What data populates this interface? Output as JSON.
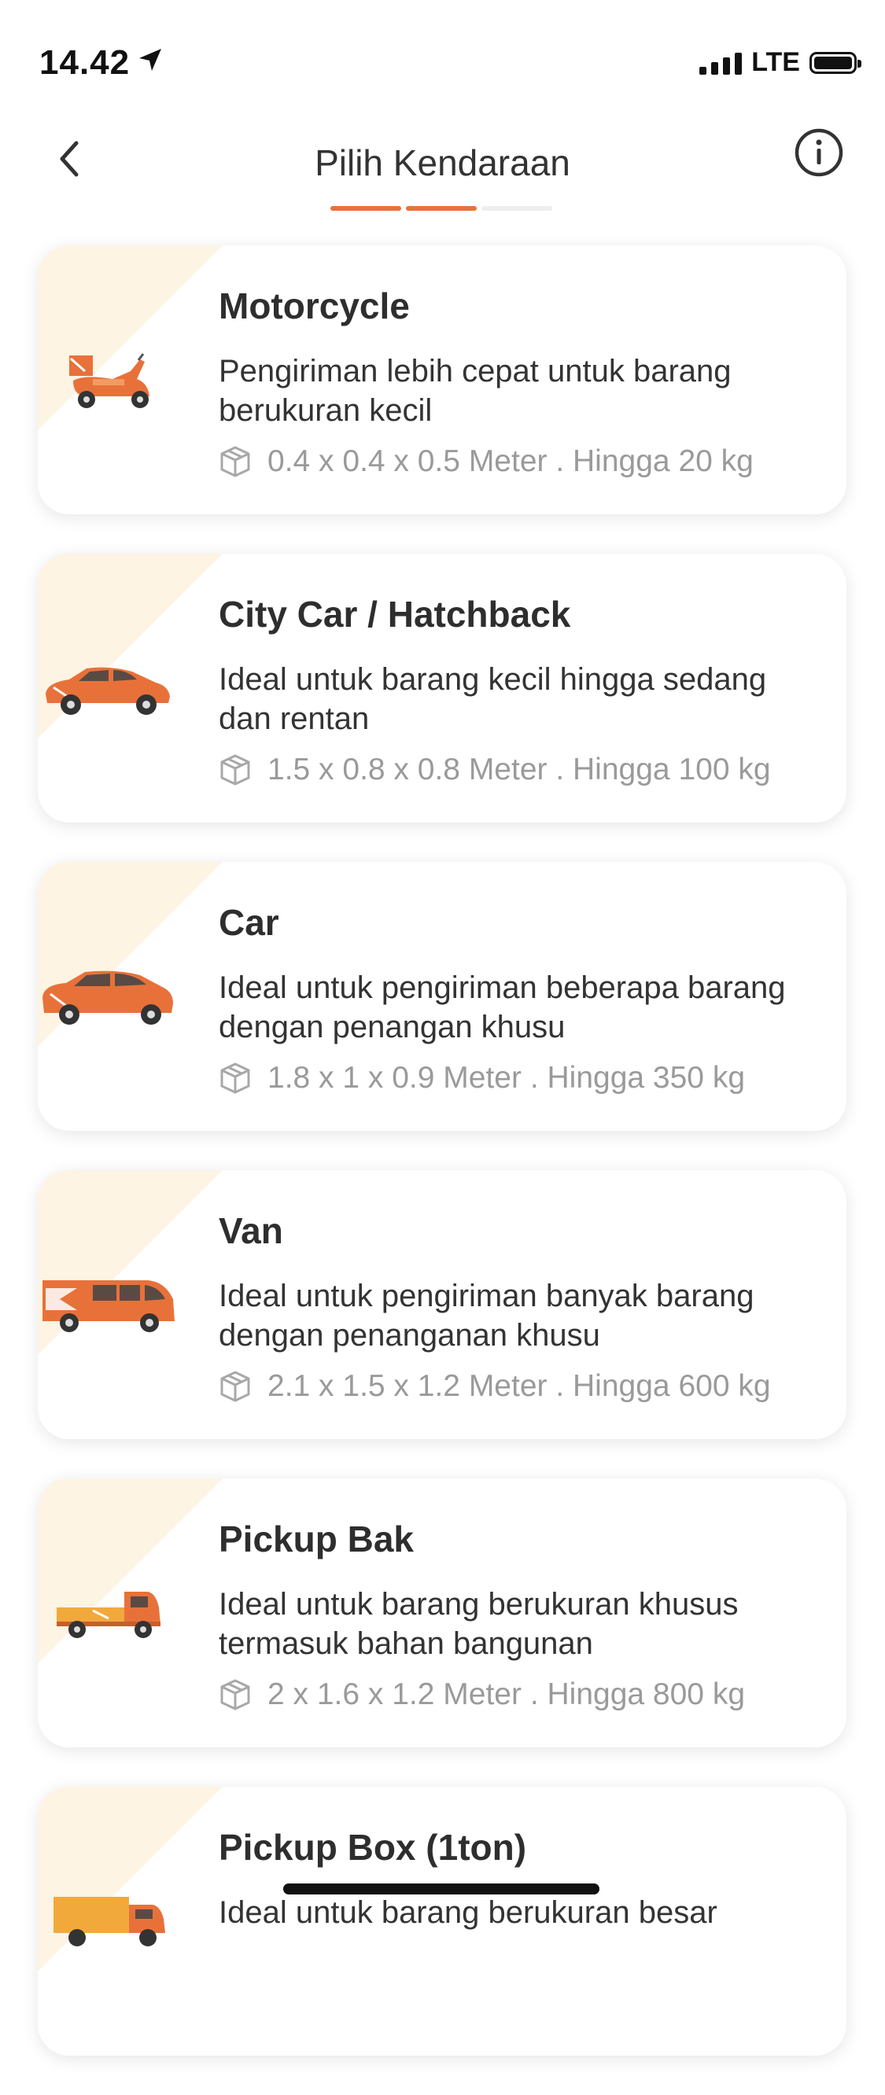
{
  "status_bar": {
    "time": "14.42",
    "network": "LTE"
  },
  "header": {
    "title": "Pilih Kendaraan",
    "steps_total": 3,
    "steps_completed": 2
  },
  "colors": {
    "accent": "#e8713a",
    "card_corner": "#fdf4e3",
    "muted": "#9a9a9a"
  },
  "vehicles": [
    {
      "name": "Motorcycle",
      "description": "Pengiriman lebih cepat untuk barang berukuran kecil",
      "spec": "0.4 x 0.4 x 0.5 Meter . Hingga 20 kg",
      "icon": "motorcycle-icon"
    },
    {
      "name": "City Car / Hatchback",
      "description": "Ideal untuk barang kecil hingga sedang dan rentan",
      "spec": "1.5 x 0.8 x 0.8 Meter . Hingga 100 kg",
      "icon": "hatchback-icon"
    },
    {
      "name": "Car",
      "description": "Ideal untuk pengiriman beberapa barang dengan penangan khusu",
      "spec": "1.8 x 1 x 0.9 Meter . Hingga 350 kg",
      "icon": "car-icon"
    },
    {
      "name": "Van",
      "description": "Ideal untuk pengiriman banyak barang dengan penanganan khusu",
      "spec": "2.1 x 1.5 x 1.2 Meter . Hingga 600 kg",
      "icon": "van-icon"
    },
    {
      "name": "Pickup Bak",
      "description": "Ideal untuk barang berukuran khusus termasuk bahan bangunan",
      "spec": "2 x 1.6 x 1.2 Meter . Hingga 800 kg",
      "icon": "pickup-icon"
    },
    {
      "name": "Pickup Box (1ton)",
      "description": "Ideal untuk barang berukuran besar",
      "spec": "",
      "icon": "pickup-box-icon"
    }
  ]
}
